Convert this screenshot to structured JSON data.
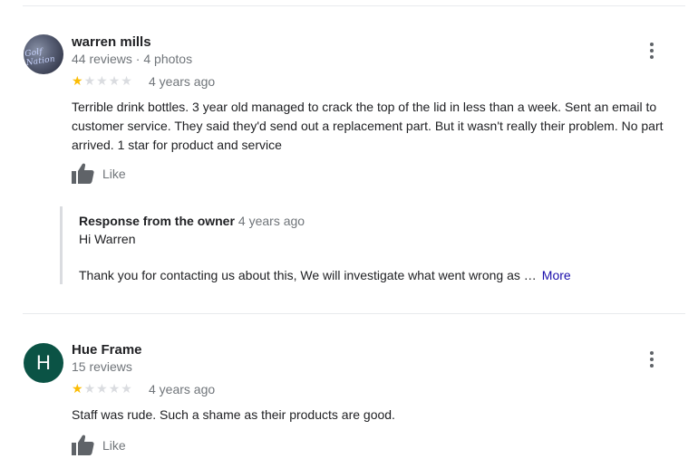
{
  "reviews": [
    {
      "author": "warren mills",
      "meta": "44 reviews · 4 photos",
      "avatar_type": "photo",
      "avatar_text": "Golf Nation",
      "rating": 1,
      "max_rating": 5,
      "date": "4 years ago",
      "text": "Terrible drink bottles. 3 year old managed to crack the top of the lid in less than a week. Sent an email to customer service. They said they'd send out a replacement part. But it wasn't really their problem. No part arrived. 1 star for product and service",
      "like_label": "Like",
      "owner_response": {
        "title": "Response from the owner",
        "date": "4 years ago",
        "greeting": "Hi Warren",
        "excerpt": "Thank you for contacting us about this, We will investigate what went wrong as …",
        "more_label": "More"
      }
    },
    {
      "author": "Hue Frame",
      "meta": "15 reviews",
      "avatar_type": "letter",
      "avatar_letter": "H",
      "avatar_color": "#0b5345",
      "rating": 1,
      "max_rating": 5,
      "date": "4 years ago",
      "text": "Staff was rude. Such a shame as their products are good.",
      "like_label": "Like"
    }
  ],
  "colors": {
    "star_filled": "#fbbc04",
    "star_empty": "#dadce0",
    "link": "#1a0dab",
    "muted_text": "#70757a"
  },
  "icons": {
    "menu": "more-vert-icon",
    "like": "thumb-up-icon",
    "star": "star-icon"
  }
}
